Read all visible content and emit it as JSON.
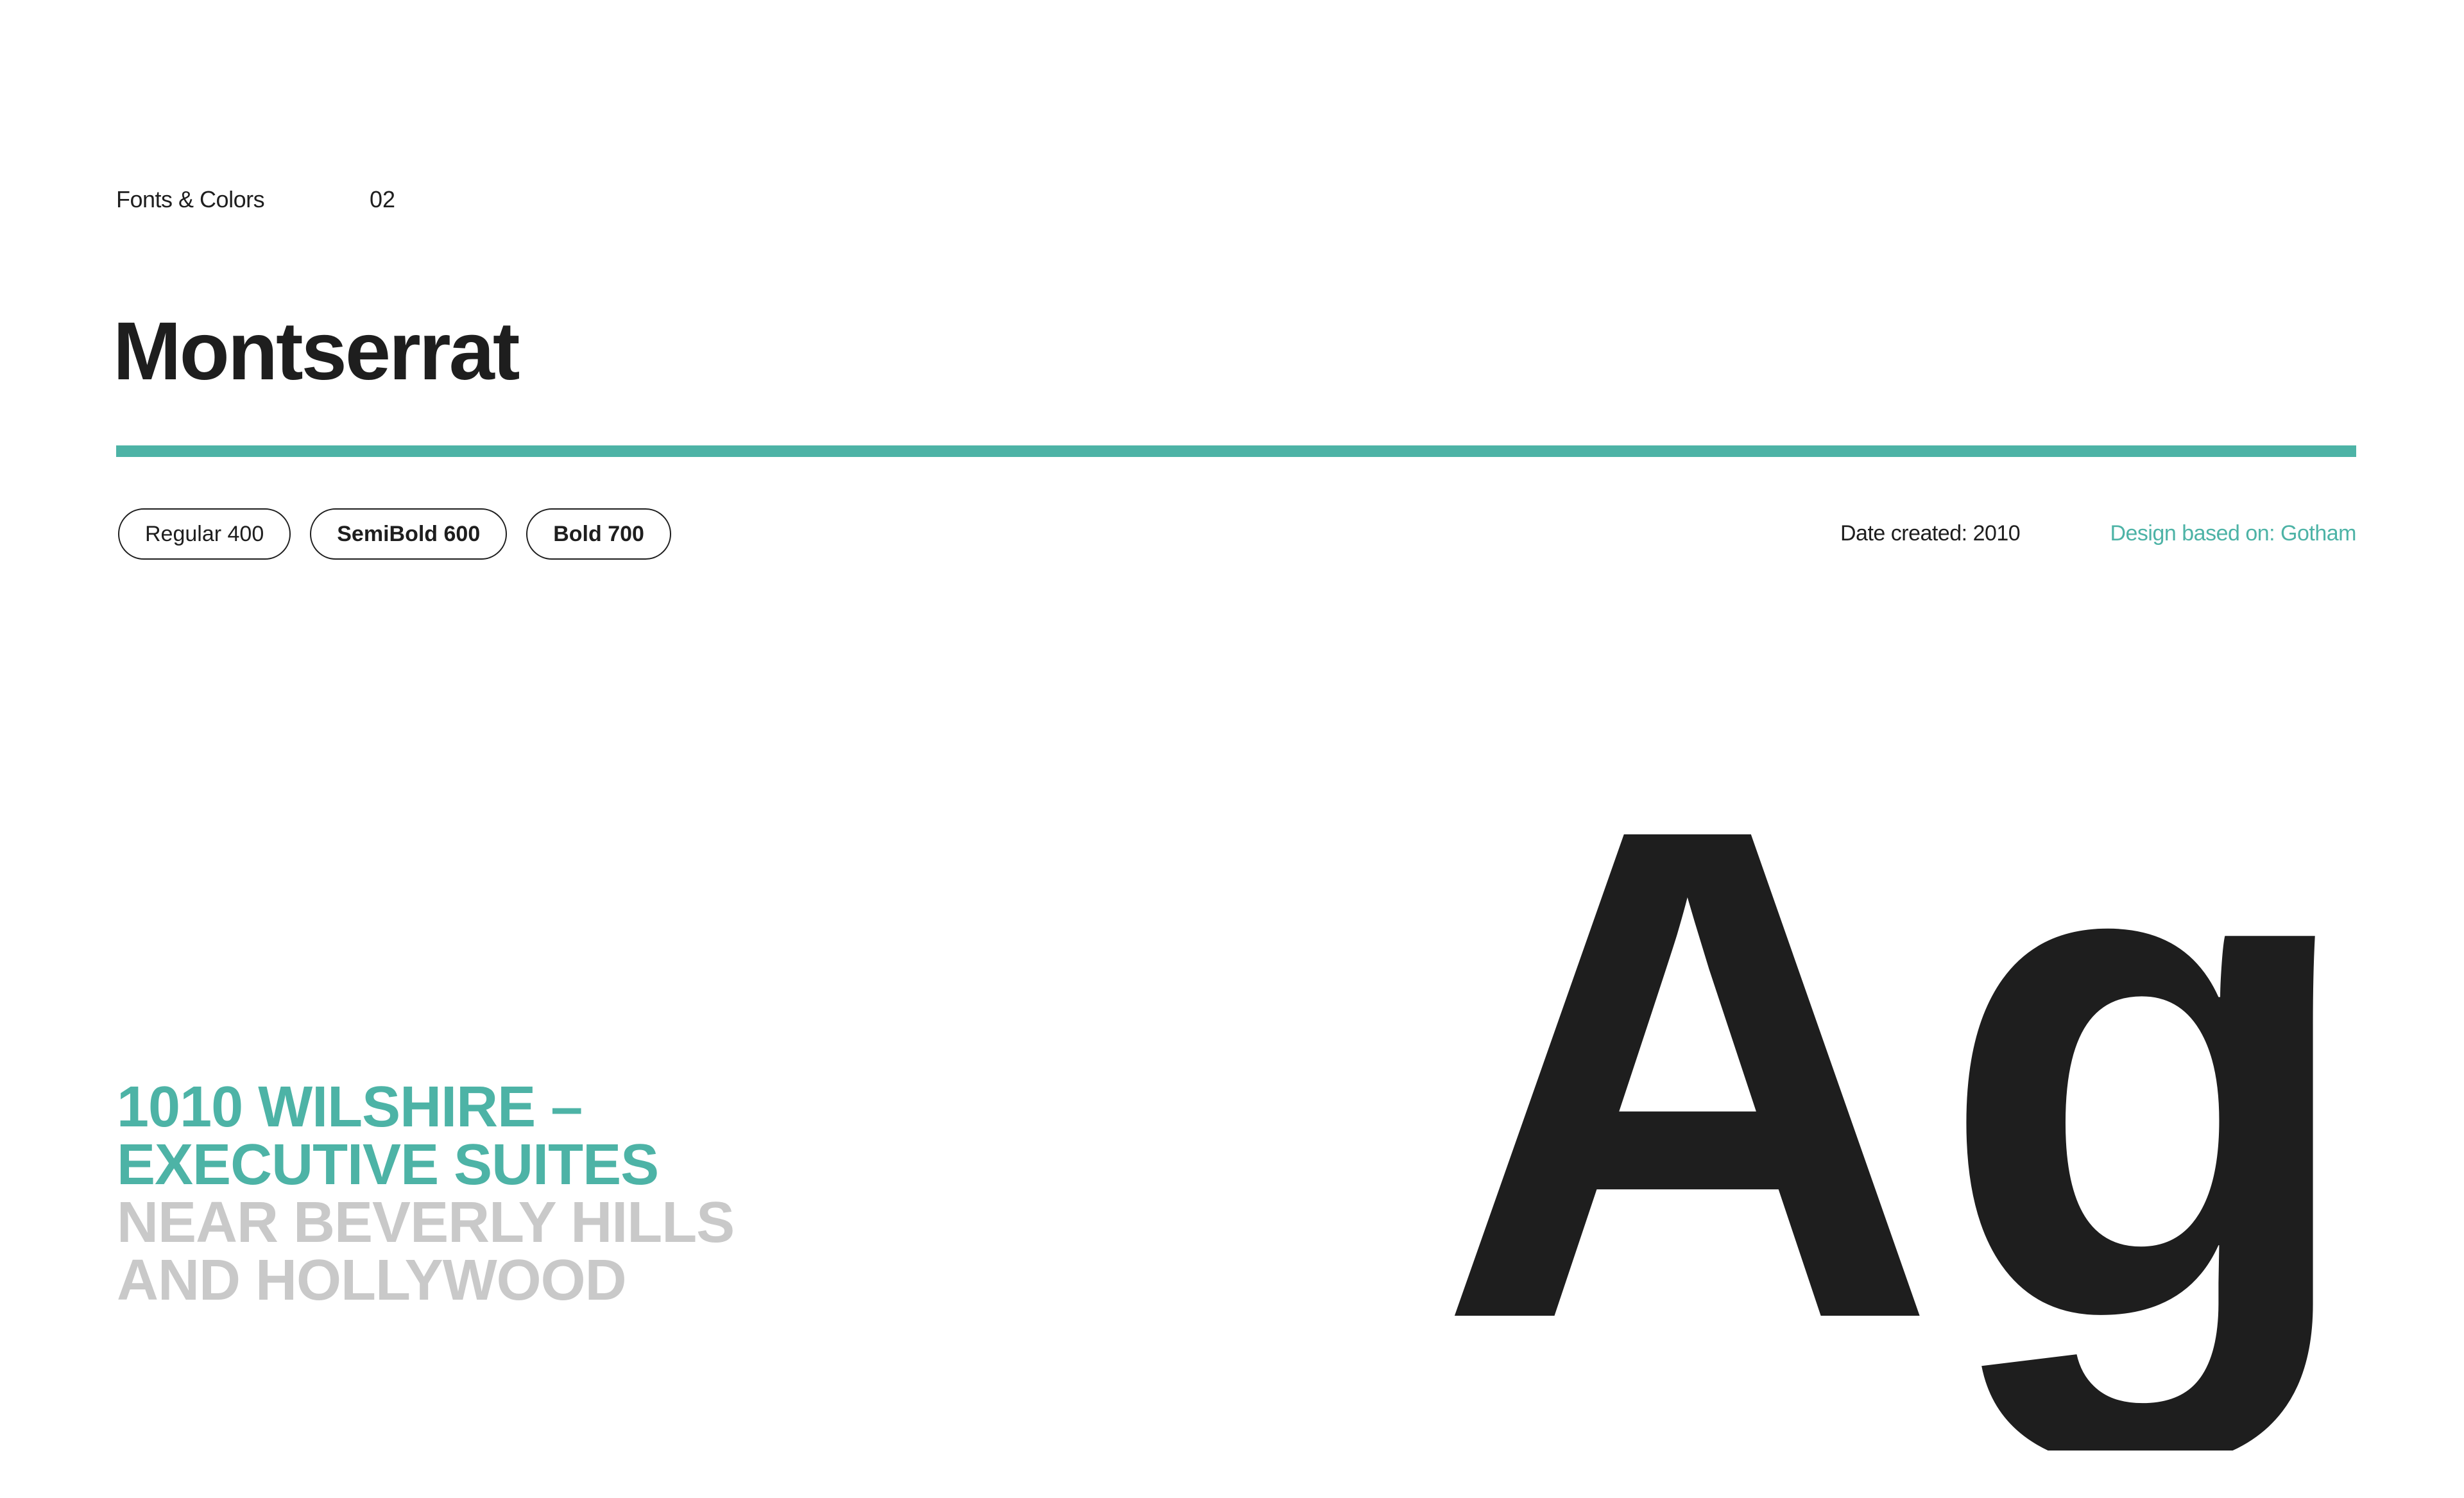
{
  "header": {
    "section_label": "Fonts & Colors",
    "section_number": "02"
  },
  "font": {
    "name": "Montserrat",
    "weights": [
      {
        "label": "Regular 400"
      },
      {
        "label": "SemiBold 600"
      },
      {
        "label": "Bold 700"
      }
    ],
    "date_created": "Date created: 2010",
    "design_based_on": "Design based on: Gotham",
    "glyph_sample": "Ag"
  },
  "sample": {
    "lines": [
      {
        "text": "1010 WILSHIRE –",
        "tone": "accent"
      },
      {
        "text": "EXECUTIVE SUITES",
        "tone": "accent"
      },
      {
        "text": "NEAR BEVERLY HILLS",
        "tone": "muted"
      },
      {
        "text": "AND HOLLYWOOD",
        "tone": "muted"
      }
    ]
  },
  "colors": {
    "accent": "#4db3a6",
    "text": "#1e1e1e",
    "muted": "#c9c9c9",
    "background": "#ffffff"
  }
}
